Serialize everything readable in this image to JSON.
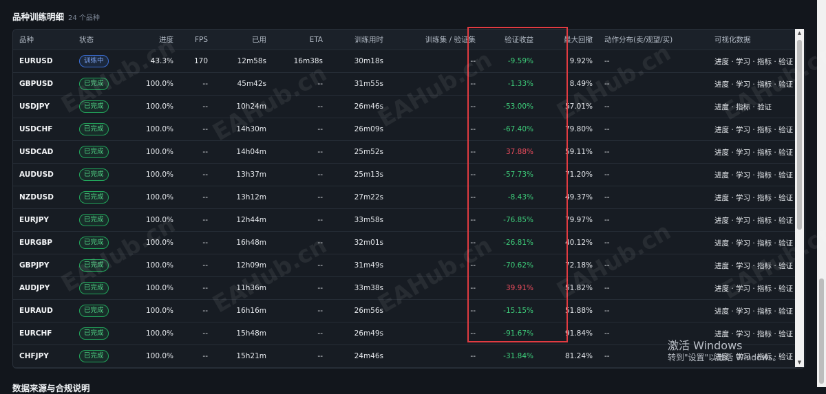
{
  "section": {
    "title": "品种训练明细",
    "count": "24 个品种"
  },
  "columns": {
    "symbol": "品种",
    "status": "状态",
    "progress": "进度",
    "fps": "FPS",
    "used": "已用",
    "eta": "ETA",
    "train_time": "训练用时",
    "sets": "训练集 / 验证集",
    "val_return": "验证收益",
    "max_dd": "最大回撤",
    "actions": "动作分布(卖/观望/买)",
    "viz": "可视化数据"
  },
  "rows": [
    {
      "symbol": "EURUSD",
      "status": "训练中",
      "state": "training",
      "progress": "43.3%",
      "fps": "170",
      "used": "12m58s",
      "eta": "16m38s",
      "train_time": "30m18s",
      "sets": "--",
      "val_return": "-9.59%",
      "val_sign": "pos",
      "max_dd": "9.92%",
      "actions": "--",
      "viz": "进度 · 学习 · 指标 · 验证"
    },
    {
      "symbol": "GBPUSD",
      "status": "已完成",
      "state": "done",
      "progress": "100.0%",
      "fps": "--",
      "used": "45m42s",
      "eta": "--",
      "train_time": "31m55s",
      "sets": "--",
      "val_return": "-1.33%",
      "val_sign": "pos",
      "max_dd": "8.49%",
      "actions": "--",
      "viz": "进度 · 学习 · 指标 · 验证"
    },
    {
      "symbol": "USDJPY",
      "status": "已完成",
      "state": "done",
      "progress": "100.0%",
      "fps": "--",
      "used": "10h24m",
      "eta": "--",
      "train_time": "26m46s",
      "sets": "--",
      "val_return": "-53.00%",
      "val_sign": "pos",
      "max_dd": "57.01%",
      "actions": "--",
      "viz": "进度 · 指标 · 验证"
    },
    {
      "symbol": "USDCHF",
      "status": "已完成",
      "state": "done",
      "progress": "100.0%",
      "fps": "--",
      "used": "14h30m",
      "eta": "--",
      "train_time": "26m09s",
      "sets": "--",
      "val_return": "-67.40%",
      "val_sign": "pos",
      "max_dd": "79.80%",
      "actions": "--",
      "viz": "进度 · 学习 · 指标 · 验证"
    },
    {
      "symbol": "USDCAD",
      "status": "已完成",
      "state": "done",
      "progress": "100.0%",
      "fps": "--",
      "used": "14h04m",
      "eta": "--",
      "train_time": "25m52s",
      "sets": "--",
      "val_return": "37.88%",
      "val_sign": "neg",
      "max_dd": "59.11%",
      "actions": "--",
      "viz": "进度 · 学习 · 指标 · 验证"
    },
    {
      "symbol": "AUDUSD",
      "status": "已完成",
      "state": "done",
      "progress": "100.0%",
      "fps": "--",
      "used": "13h37m",
      "eta": "--",
      "train_time": "25m13s",
      "sets": "--",
      "val_return": "-57.73%",
      "val_sign": "pos",
      "max_dd": "71.20%",
      "actions": "--",
      "viz": "进度 · 学习 · 指标 · 验证"
    },
    {
      "symbol": "NZDUSD",
      "status": "已完成",
      "state": "done",
      "progress": "100.0%",
      "fps": "--",
      "used": "13h12m",
      "eta": "--",
      "train_time": "27m22s",
      "sets": "--",
      "val_return": "-8.43%",
      "val_sign": "pos",
      "max_dd": "49.37%",
      "actions": "--",
      "viz": "进度 · 学习 · 指标 · 验证"
    },
    {
      "symbol": "EURJPY",
      "status": "已完成",
      "state": "done",
      "progress": "100.0%",
      "fps": "--",
      "used": "12h44m",
      "eta": "--",
      "train_time": "33m58s",
      "sets": "--",
      "val_return": "-76.85%",
      "val_sign": "pos",
      "max_dd": "79.97%",
      "actions": "--",
      "viz": "进度 · 学习 · 指标 · 验证"
    },
    {
      "symbol": "EURGBP",
      "status": "已完成",
      "state": "done",
      "progress": "100.0%",
      "fps": "--",
      "used": "16h48m",
      "eta": "--",
      "train_time": "32m01s",
      "sets": "--",
      "val_return": "-26.81%",
      "val_sign": "pos",
      "max_dd": "40.12%",
      "actions": "--",
      "viz": "进度 · 学习 · 指标 · 验证"
    },
    {
      "symbol": "GBPJPY",
      "status": "已完成",
      "state": "done",
      "progress": "100.0%",
      "fps": "--",
      "used": "12h09m",
      "eta": "--",
      "train_time": "31m49s",
      "sets": "--",
      "val_return": "-70.62%",
      "val_sign": "pos",
      "max_dd": "72.18%",
      "actions": "--",
      "viz": "进度 · 学习 · 指标 · 验证"
    },
    {
      "symbol": "AUDJPY",
      "status": "已完成",
      "state": "done",
      "progress": "100.0%",
      "fps": "--",
      "used": "11h36m",
      "eta": "--",
      "train_time": "33m38s",
      "sets": "--",
      "val_return": "39.91%",
      "val_sign": "neg",
      "max_dd": "51.82%",
      "actions": "--",
      "viz": "进度 · 学习 · 指标 · 验证"
    },
    {
      "symbol": "EURAUD",
      "status": "已完成",
      "state": "done",
      "progress": "100.0%",
      "fps": "--",
      "used": "16h16m",
      "eta": "--",
      "train_time": "26m56s",
      "sets": "--",
      "val_return": "-15.15%",
      "val_sign": "pos",
      "max_dd": "51.88%",
      "actions": "--",
      "viz": "进度 · 学习 · 指标 · 验证"
    },
    {
      "symbol": "EURCHF",
      "status": "已完成",
      "state": "done",
      "progress": "100.0%",
      "fps": "--",
      "used": "15h48m",
      "eta": "--",
      "train_time": "26m49s",
      "sets": "--",
      "val_return": "-91.67%",
      "val_sign": "pos",
      "max_dd": "91.84%",
      "actions": "--",
      "viz": "进度 · 学习 · 指标 · 验证"
    },
    {
      "symbol": "CHFJPY",
      "status": "已完成",
      "state": "done",
      "progress": "100.0%",
      "fps": "--",
      "used": "15h21m",
      "eta": "--",
      "train_time": "24m46s",
      "sets": "--",
      "val_return": "-31.84%",
      "val_sign": "pos",
      "max_dd": "81.24%",
      "actions": "--",
      "viz": "进度 · 学习 · 指标 · 验证"
    }
  ],
  "watermark": "EAHub.cn",
  "windows_activation": {
    "line1": "激活 Windows",
    "line2": "转到\"设置\"以激活 Windows。"
  },
  "next_section_title": "数据来源与合规说明",
  "colors": {
    "positive": "#3ecf7b",
    "negative": "#ef4d5e",
    "highlight_box": "#e23b41",
    "done_badge": "#22a55b",
    "training_badge": "#3b6fd8"
  }
}
